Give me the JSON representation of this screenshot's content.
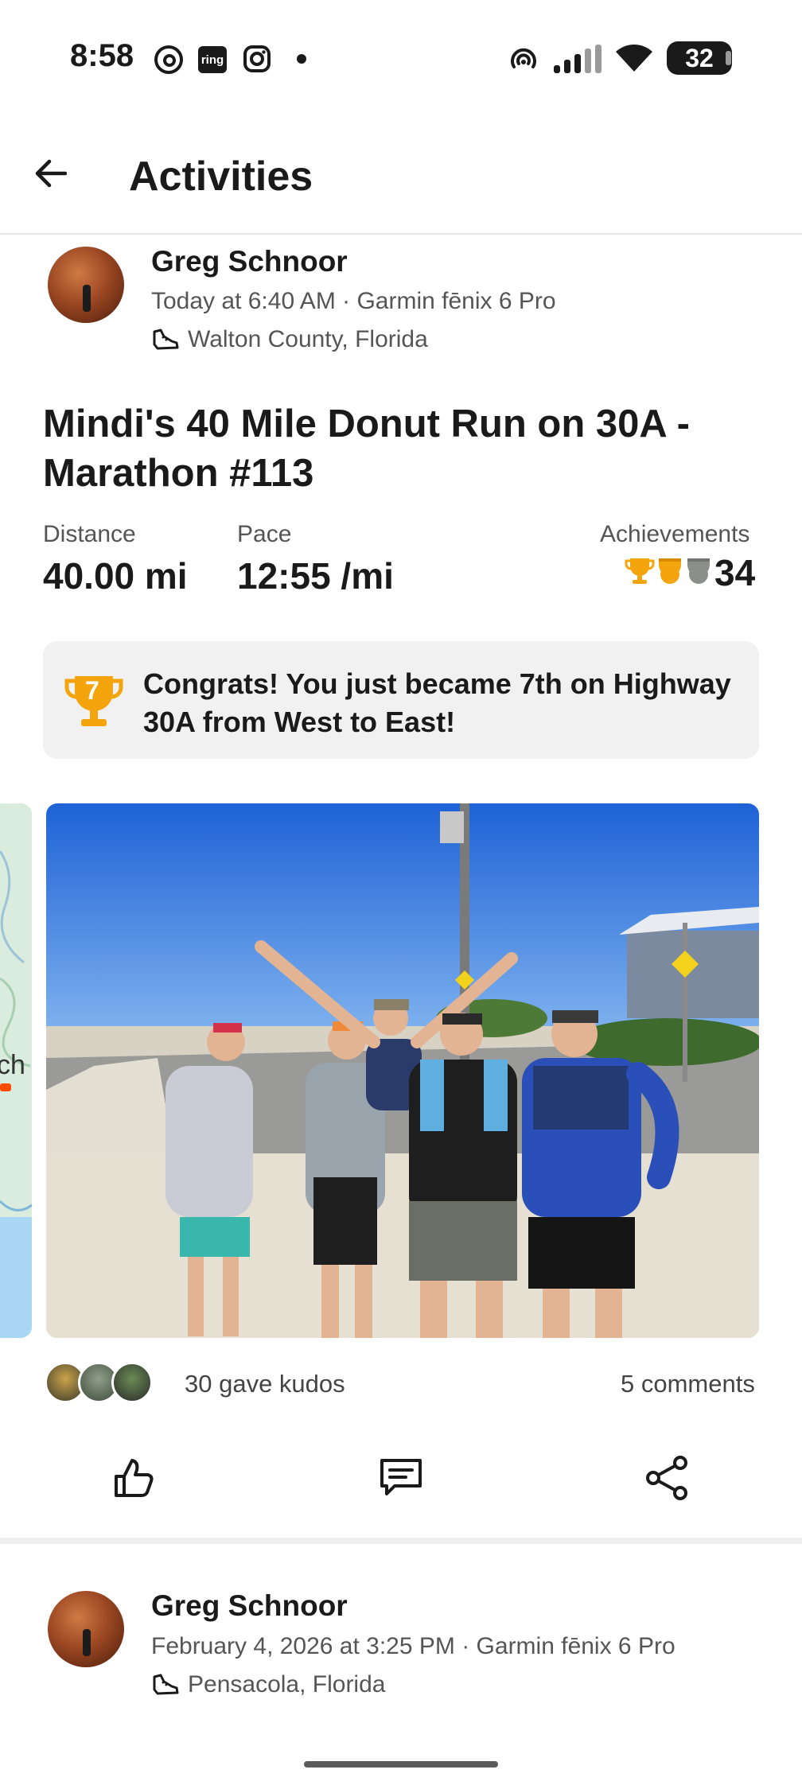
{
  "status_bar": {
    "time": "8:58",
    "left_icons": [
      "threads-icon",
      "ring-icon",
      "instagram-icon",
      "dot-icon"
    ],
    "ring_label": "ring",
    "battery": "32"
  },
  "app_bar": {
    "title": "Activities"
  },
  "activity": {
    "athlete_name": "Greg Schnoor",
    "meta": "Today at 6:40 AM · Garmin fēnix 6 Pro",
    "location": "Walton County, Florida",
    "title": "Mindi's 40 Mile Donut Run on 30A - Marathon  #113",
    "stats": {
      "distance_label": "Distance",
      "distance_value": "40.00 mi",
      "pace_label": "Pace",
      "pace_value": "12:55 /mi",
      "achievements_label": "Achievements",
      "achievements_count": "34"
    },
    "congrats": {
      "rank": "7",
      "text": "Congrats! You just became 7th on Highway 30A from West to East!"
    },
    "map_peek_text": "ch",
    "kudos_text": "30 gave kudos",
    "comments_text": "5 comments"
  },
  "next_activity": {
    "athlete_name": "Greg Schnoor",
    "meta": "February 4, 2026 at 3:25 PM · Garmin fēnix 6 Pro",
    "location": "Pensacola, Florida"
  },
  "colors": {
    "gold": "#f4a40c",
    "silver": "#8a8f8c",
    "strava_orange": "#fc4c02"
  }
}
